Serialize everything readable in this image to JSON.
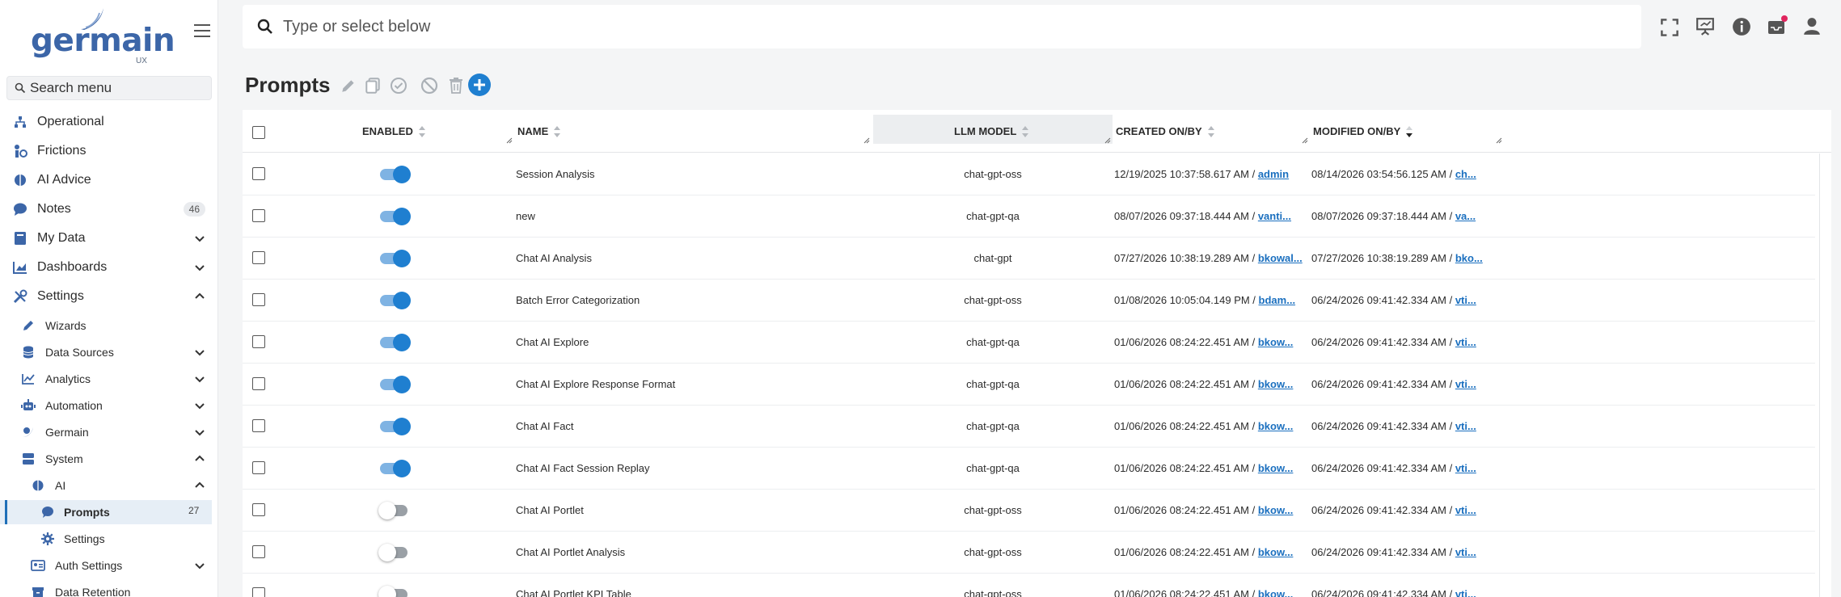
{
  "app": {
    "logo_text": "germain",
    "logo_sub": "UX"
  },
  "search_menu": {
    "placeholder": "Search menu"
  },
  "topbar": {
    "search_placeholder": "Type or select below"
  },
  "sidebar": {
    "items": [
      {
        "label": "Operational"
      },
      {
        "label": "Frictions"
      },
      {
        "label": "AI Advice"
      },
      {
        "label": "Notes",
        "badge": "46"
      },
      {
        "label": "My Data"
      },
      {
        "label": "Dashboards"
      },
      {
        "label": "Settings"
      },
      {
        "label": "Wizards"
      },
      {
        "label": "Data Sources"
      },
      {
        "label": "Analytics"
      },
      {
        "label": "Automation"
      },
      {
        "label": "Germain"
      },
      {
        "label": "System"
      },
      {
        "label": "AI"
      },
      {
        "label": "Prompts",
        "badge": "27"
      },
      {
        "label": "Settings"
      },
      {
        "label": "Auth Settings"
      },
      {
        "label": "Data Retention"
      }
    ]
  },
  "page": {
    "title": "Prompts"
  },
  "table": {
    "columns": {
      "enabled": "ENABLED",
      "name": "NAME",
      "llm": "LLM MODEL",
      "created": "CREATED ON/BY",
      "modified": "MODIFIED ON/BY"
    },
    "rows": [
      {
        "enabled": true,
        "name": "Session Analysis",
        "llm": "chat-gpt-oss",
        "created": "12/19/2025 10:37:58.617 AM /",
        "created_by": "admin",
        "modified": "08/14/2026 03:54:56.125 AM /",
        "modified_by": "ch..."
      },
      {
        "enabled": true,
        "name": "new",
        "llm": "chat-gpt-qa",
        "created": "08/07/2026 09:37:18.444 AM /",
        "created_by": "vanti...",
        "modified": "08/07/2026 09:37:18.444 AM /",
        "modified_by": "va..."
      },
      {
        "enabled": true,
        "name": "Chat AI Analysis",
        "llm": "chat-gpt",
        "created": "07/27/2026 10:38:19.289 AM /",
        "created_by": "bkowal...",
        "modified": "07/27/2026 10:38:19.289 AM /",
        "modified_by": "bko..."
      },
      {
        "enabled": true,
        "name": "Batch Error Categorization",
        "llm": "chat-gpt-oss",
        "created": "01/08/2026 10:05:04.149 PM /",
        "created_by": "bdam...",
        "modified": "06/24/2026 09:41:42.334 AM /",
        "modified_by": "vti..."
      },
      {
        "enabled": true,
        "name": "Chat AI Explore",
        "llm": "chat-gpt-qa",
        "created": "01/06/2026 08:24:22.451 AM /",
        "created_by": "bkow...",
        "modified": "06/24/2026 09:41:42.334 AM /",
        "modified_by": "vti..."
      },
      {
        "enabled": true,
        "name": "Chat AI Explore Response Format",
        "llm": "chat-gpt-qa",
        "created": "01/06/2026 08:24:22.451 AM /",
        "created_by": "bkow...",
        "modified": "06/24/2026 09:41:42.334 AM /",
        "modified_by": "vti..."
      },
      {
        "enabled": true,
        "name": "Chat AI Fact",
        "llm": "chat-gpt-qa",
        "created": "01/06/2026 08:24:22.451 AM /",
        "created_by": "bkow...",
        "modified": "06/24/2026 09:41:42.334 AM /",
        "modified_by": "vti..."
      },
      {
        "enabled": true,
        "name": "Chat AI Fact Session Replay",
        "llm": "chat-gpt-qa",
        "created": "01/06/2026 08:24:22.451 AM /",
        "created_by": "bkow...",
        "modified": "06/24/2026 09:41:42.334 AM /",
        "modified_by": "vti..."
      },
      {
        "enabled": false,
        "name": "Chat AI Portlet",
        "llm": "chat-gpt-oss",
        "created": "01/06/2026 08:24:22.451 AM /",
        "created_by": "bkow...",
        "modified": "06/24/2026 09:41:42.334 AM /",
        "modified_by": "vti..."
      },
      {
        "enabled": false,
        "name": "Chat AI Portlet Analysis",
        "llm": "chat-gpt-oss",
        "created": "01/06/2026 08:24:22.451 AM /",
        "created_by": "bkow...",
        "modified": "06/24/2026 09:41:42.334 AM /",
        "modified_by": "vti..."
      },
      {
        "enabled": false,
        "name": "Chat AI Portlet KPI Table",
        "llm": "chat-gpt-oss",
        "created": "01/06/2026 08:24:22.451 AM /",
        "created_by": "bkow...",
        "modified": "06/24/2026 09:41:42.334 AM /",
        "modified_by": "vti..."
      }
    ]
  },
  "colors": {
    "accent": "#1f7fd0",
    "link": "#1a6fbf",
    "brand": "#3c66a8",
    "notification": "#e0245e"
  },
  "icons": [
    "search-icon",
    "fullscreen-icon",
    "presentation-icon",
    "info-icon",
    "inbox-icon",
    "user-icon",
    "edit-icon",
    "copy-icon",
    "check-circle-icon",
    "ban-icon",
    "trash-icon",
    "plus-icon"
  ]
}
